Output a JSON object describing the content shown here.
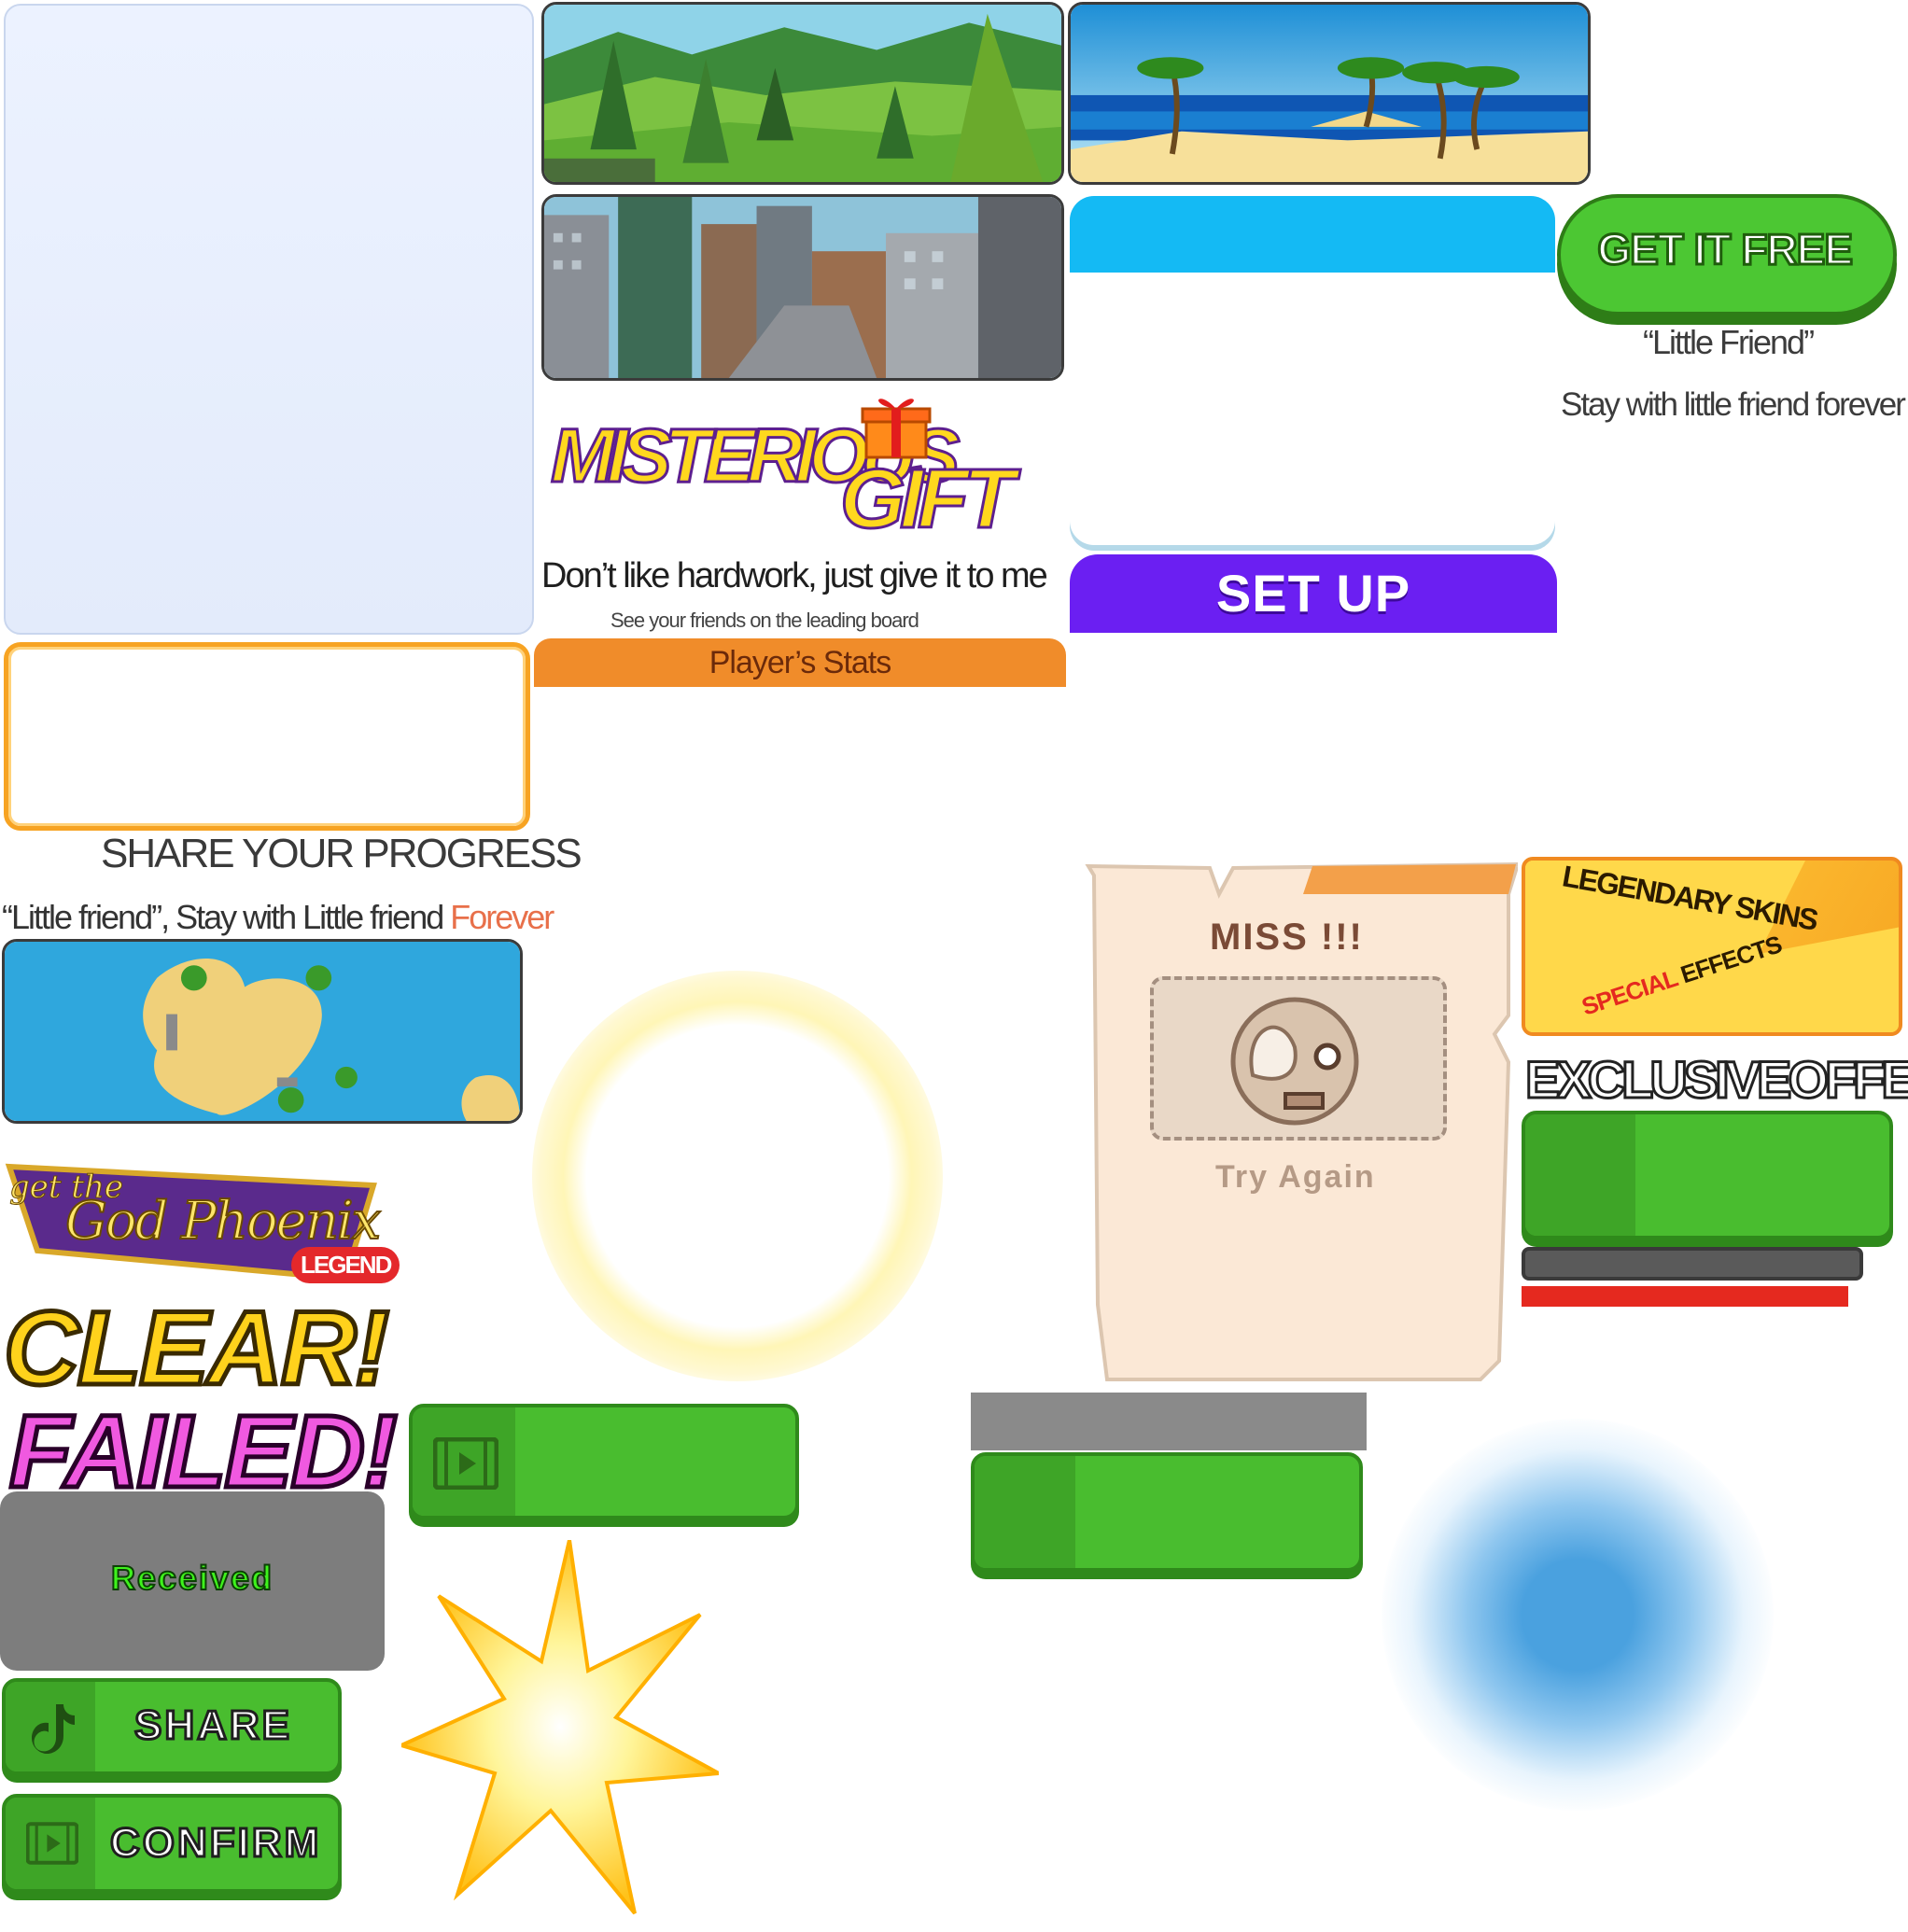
{
  "gift": {
    "title_1": "MISTERIOUS",
    "title_2": "GIFT",
    "tagline": "Don’t like hardwork, just give it to me",
    "sub": "See your friends on the leading board"
  },
  "stats": {
    "header": "Player’s Stats"
  },
  "setup": {
    "button": "SET UP"
  },
  "offer": {
    "get_free": "GET IT FREE",
    "name": "“Little Friend”",
    "desc": "Stay with little friend forever"
  },
  "share_progress": {
    "title": "SHARE YOUR PROGRESS",
    "caption_main": "“Little friend”, Stay with Little friend ",
    "caption_highlight": "Forever"
  },
  "logo": {
    "line1": "get the",
    "line2": "God Phoenix",
    "badge": "LEGEND"
  },
  "result": {
    "clear": "CLEAR!",
    "failed": "FAILED!"
  },
  "miss": {
    "title": "MISS !!!",
    "retry": "Try Again"
  },
  "skins": {
    "line1": "LEGENDARY SKINS",
    "line2a": "SPECIAL",
    "line2b": "EFFECTS"
  },
  "exclusive": {
    "label": "EXCLUSIVEOFFERS"
  },
  "received": {
    "label": "Received"
  },
  "buttons": {
    "share": "SHARE",
    "confirm": "CONFIRM"
  },
  "icons": {
    "film": "film-strip-icon",
    "tiktok": "tiktok-icon",
    "gift": "gift-box-icon",
    "ghost": "ghost-face-icon"
  },
  "colors": {
    "green": "#4cc733",
    "blue_header": "#14baf4",
    "purple": "#6b1ff2",
    "orange": "#f08c2a",
    "red": "#e5291f"
  }
}
